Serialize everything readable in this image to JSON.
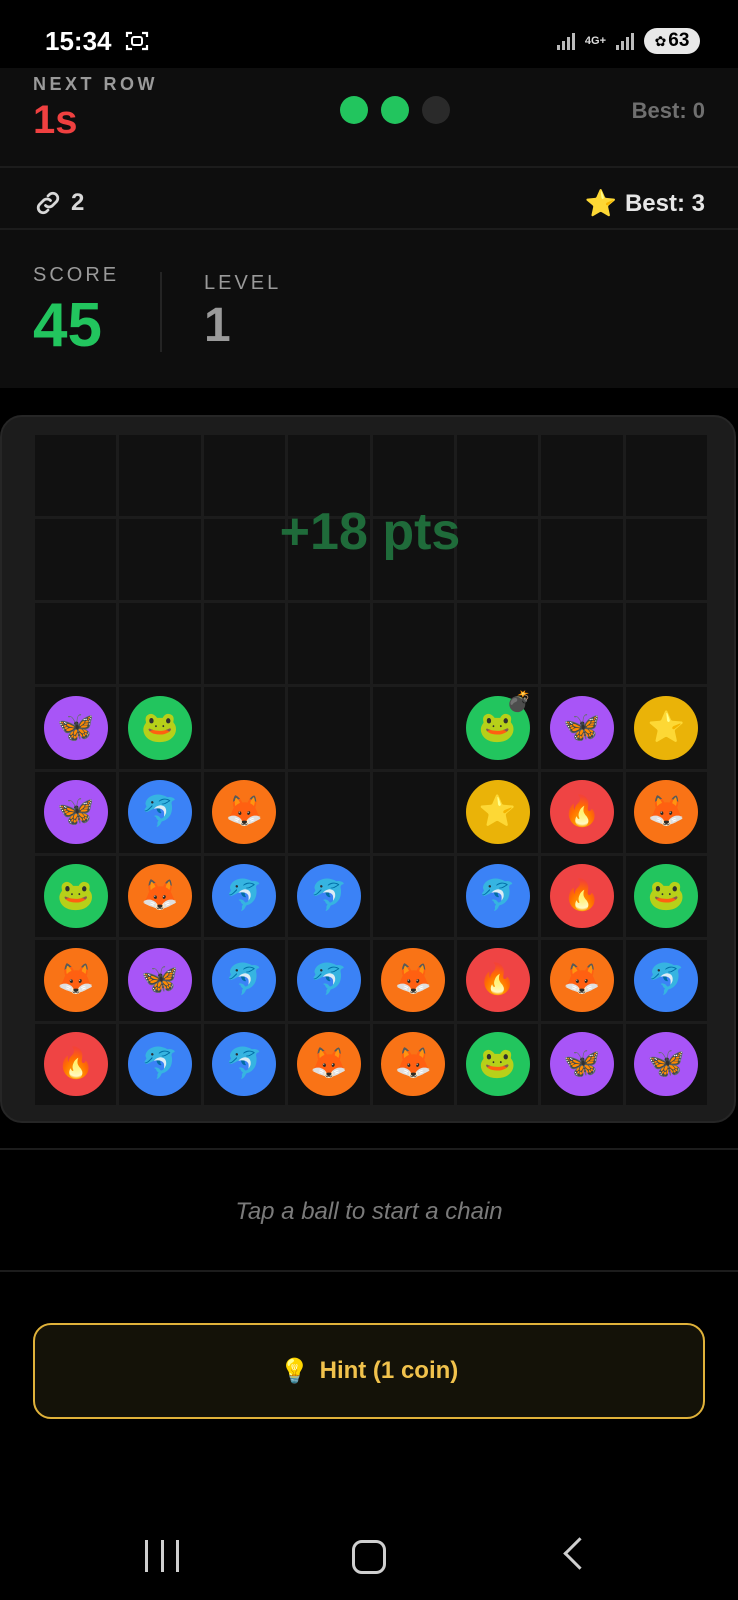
{
  "status_bar": {
    "time": "15:34",
    "network": "4G+",
    "battery": "63"
  },
  "header": {
    "next_row_label": "NEXT ROW",
    "next_row_value": "1s",
    "row_progress": {
      "filled": 2,
      "total": 3
    },
    "best_top": "Best: 0",
    "chain_count": "2",
    "star_best": "Best: 3",
    "score_label": "SCORE",
    "score_value": "45",
    "level_label": "LEVEL",
    "level_value": "1"
  },
  "board": {
    "points_popup": "+18 pts",
    "rows": [
      [
        null,
        null,
        null,
        null,
        null,
        null,
        null,
        null
      ],
      [
        null,
        null,
        null,
        null,
        null,
        null,
        null,
        null
      ],
      [
        null,
        null,
        null,
        null,
        null,
        null,
        null,
        null
      ],
      [
        "butterfly",
        "frog",
        null,
        null,
        null,
        "frog-bomb",
        "butterfly",
        "star"
      ],
      [
        "butterfly",
        "dolphin",
        "fox",
        null,
        null,
        "star",
        "fire",
        "fox"
      ],
      [
        "frog",
        "fox",
        "dolphin",
        "dolphin",
        null,
        "dolphin",
        "fire",
        "frog"
      ],
      [
        "fox",
        "butterfly",
        "dolphin",
        "dolphin",
        "fox",
        "fire",
        "fox",
        "dolphin"
      ],
      [
        "fire",
        "dolphin",
        "dolphin",
        "fox",
        "fox",
        "frog",
        "butterfly",
        "butterfly"
      ]
    ]
  },
  "footer": {
    "instruction": "Tap a ball to start a chain",
    "hint_label": "Hint (1 coin)"
  }
}
